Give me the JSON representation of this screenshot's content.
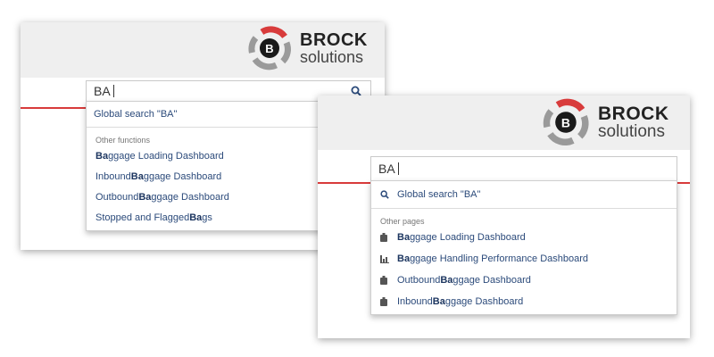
{
  "left_panel": {
    "brand": "BROCK",
    "brand_sub": "solutions",
    "logo_letter": "B",
    "search_value": "BA",
    "global_search": "Global search \"BA\"",
    "section_label": "Other functions",
    "items": [
      {
        "pre": "",
        "bold": "Ba",
        "post": "ggage Loading Dashboard"
      },
      {
        "pre": "Inbound ",
        "bold": "Ba",
        "post": "ggage Dashboard"
      },
      {
        "pre": "Outbound ",
        "bold": "Ba",
        "post": "ggage Dashboard"
      },
      {
        "pre": "Stopped and Flagged ",
        "bold": "Ba",
        "post": "gs"
      }
    ]
  },
  "right_panel": {
    "brand": "BROCK",
    "brand_sub": "solutions",
    "logo_letter": "B",
    "search_value": "BA",
    "global_search": "Global search \"BA\"",
    "section_label": "Other pages",
    "items": [
      {
        "icon": "dashboard-icon",
        "pre": "",
        "bold": "Ba",
        "post": "ggage Loading Dashboard"
      },
      {
        "icon": "bar-chart-icon",
        "pre": "",
        "bold": "Ba",
        "post": "ggage Handling Performance Dashboard"
      },
      {
        "icon": "dashboard-icon",
        "pre": "Outbound ",
        "bold": "Ba",
        "post": "ggage Dashboard"
      },
      {
        "icon": "dashboard-icon",
        "pre": "Inbound ",
        "bold": "Ba",
        "post": "ggage Dashboard"
      }
    ]
  },
  "colors": {
    "accent_red": "#d83b3b",
    "link_blue": "#2b4a7a",
    "header_gray": "#efefef"
  }
}
